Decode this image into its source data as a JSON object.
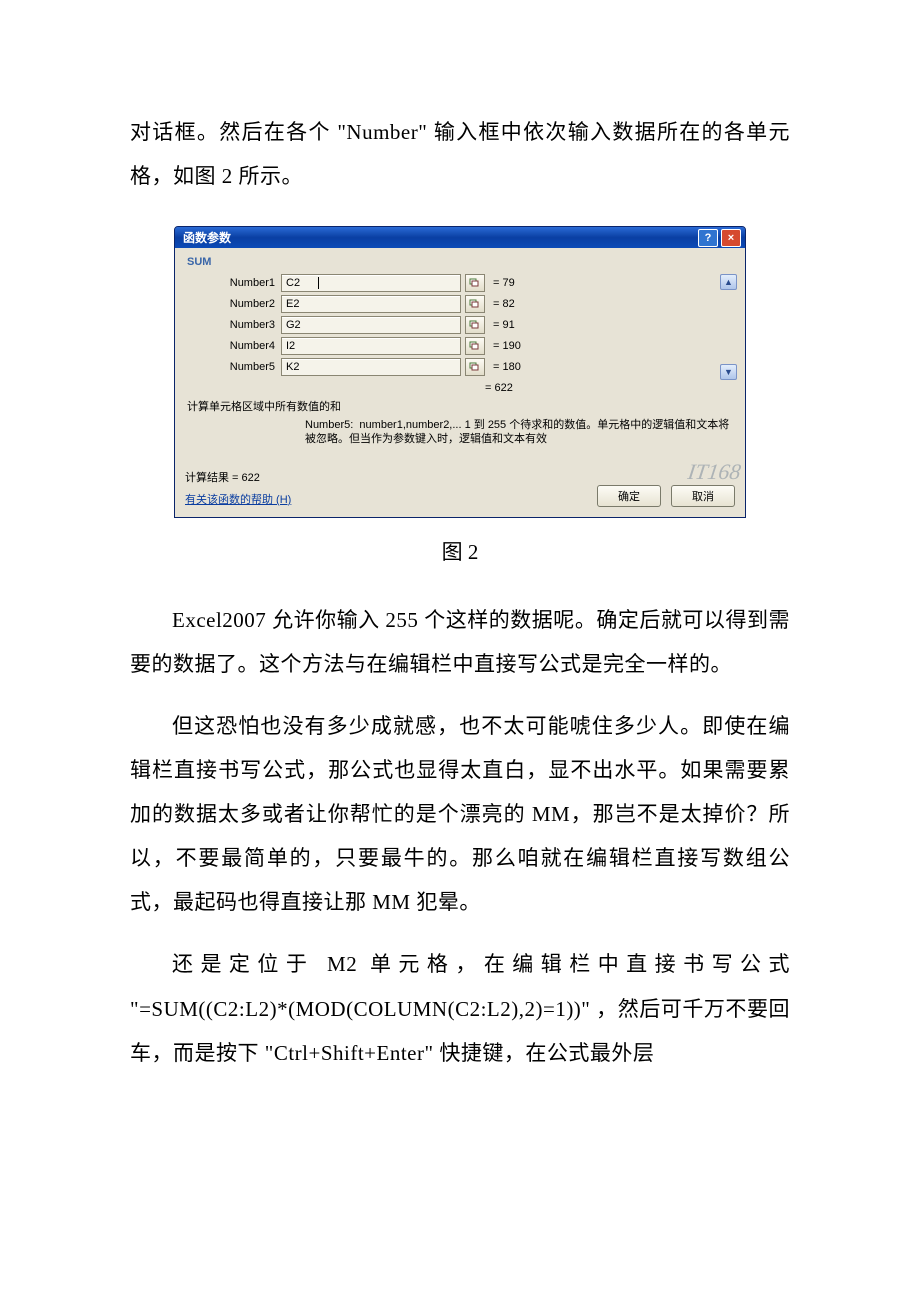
{
  "para1": "对话框。然后在各个 \"Number\" 输入框中依次输入数据所在的各单元格，如图 2 所示。",
  "caption": "图 2",
  "para2": "Excel2007 允许你输入 255 个这样的数据呢。确定后就可以得到需要的数据了。这个方法与在编辑栏中直接写公式是完全一样的。",
  "para3": "但这恐怕也没有多少成就感，也不太可能唬住多少人。即使在编辑栏直接书写公式，那公式也显得太直白，显不出水平。如果需要累加的数据太多或者让你帮忙的是个漂亮的 MM，那岂不是太掉价？所以，不要最简单的，只要最牛的。那么咱就在编辑栏直接写数组公式，最起码也得直接让那 MM 犯晕。",
  "para4": "还是定位于 M2 单元格，在编辑栏中直接书写公式 \"=SUM((C2:L2)*(MOD(COLUMN(C2:L2),2)=1))\" ，然后可千万不要回车，而是按下 \"Ctrl+Shift+Enter\" 快捷键，在公式最外层",
  "dialog": {
    "title": "函数参数",
    "func": "SUM",
    "rows": [
      {
        "label": "Number1",
        "value": "C2",
        "result": "= 79",
        "cursor": true
      },
      {
        "label": "Number2",
        "value": "E2",
        "result": "= 82",
        "cursor": false
      },
      {
        "label": "Number3",
        "value": "G2",
        "result": "= 91",
        "cursor": false
      },
      {
        "label": "Number4",
        "value": "I2",
        "result": "= 190",
        "cursor": false
      },
      {
        "label": "Number5",
        "value": "K2",
        "result": "= 180",
        "cursor": false
      }
    ],
    "total": "= 622",
    "desc": "计算单元格区域中所有数值的和",
    "hintLabel": "Number5:",
    "hintText": "number1,number2,... 1 到 255 个待求和的数值。单元格中的逻辑值和文本将被忽略。但当作为参数键入时，逻辑值和文本有效",
    "resultLabel": "计算结果 = 622",
    "helpLink": "有关该函数的帮助 (H)",
    "okBtn": "确定",
    "cancelBtn": "取消",
    "watermark": "IT168"
  }
}
